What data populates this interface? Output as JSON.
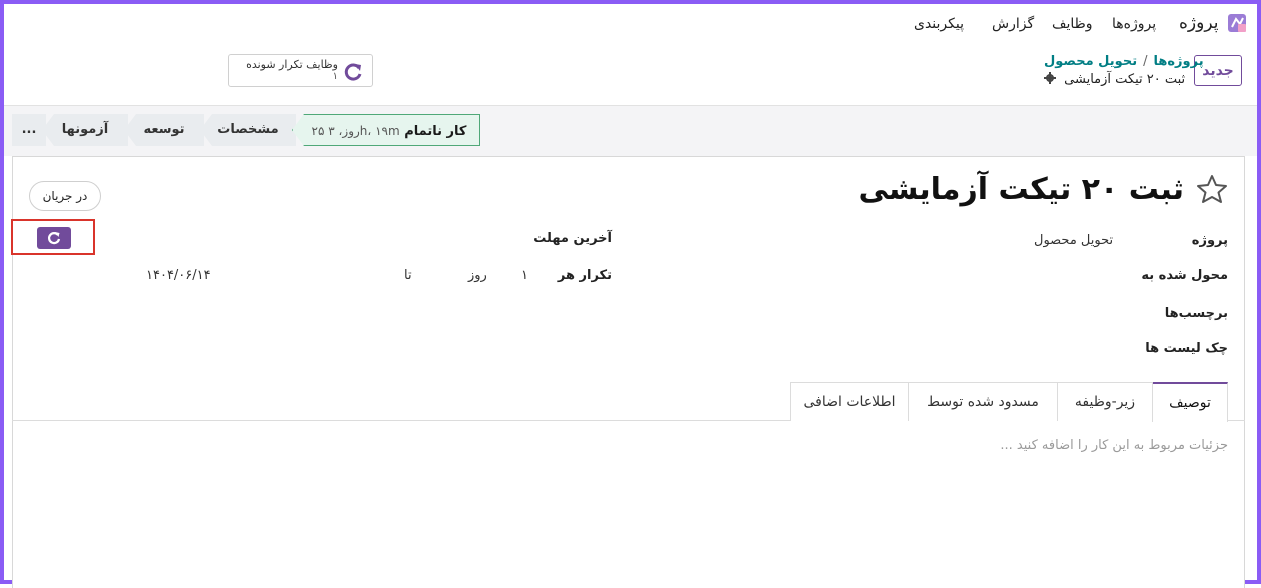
{
  "nav": {
    "brand": "پروژه",
    "items": [
      "پروژه‌ها",
      "وظایف",
      "گزارش",
      "پیکربندی"
    ]
  },
  "control": {
    "new_label": "جدید",
    "breadcrumb": [
      "پروژه‌ها",
      "تحویل محصول"
    ],
    "breadcrumb_sep": "/",
    "current": "ثبت ۲۰ تیکت آزمایشی",
    "recurring_label": "وظایف تکرار شونده",
    "recurring_count": "۱"
  },
  "stages": {
    "active_label": "کار ناتمام",
    "active_meta": "۲۵ روز، ۳h، ۱۹m",
    "items": [
      "مشخصات",
      "توسعه",
      "آزمونها",
      "..."
    ]
  },
  "task": {
    "title": "ثبت ۲۰ تیکت آزمایشی",
    "state_label": "در جریان",
    "fields": {
      "project_label": "پروژه",
      "project_value": "تحویل محصول",
      "assignee_label": "محول شده به",
      "tags_label": "برچسب‌ها",
      "checklist_label": "چک لیست ها",
      "deadline_label": "آخرین مهلت",
      "repeat_label": "تکرار هر",
      "repeat_interval": "۱",
      "repeat_unit": "روز",
      "repeat_until_label": "تا",
      "repeat_until": "۱۴۰۴/۰۶/۱۴"
    }
  },
  "tabs": [
    "توصیف",
    "زیر-وظیفه",
    "مسدود شده توسط",
    "اطلاعات اضافی"
  ],
  "description_placeholder": "جزئیات مربوط به این کار را اضافه کنید ...",
  "colors": {
    "primary": "#714b9b",
    "accent_link": "#017e84",
    "highlight": "#d9342b",
    "frame": "#8a5cf5"
  }
}
